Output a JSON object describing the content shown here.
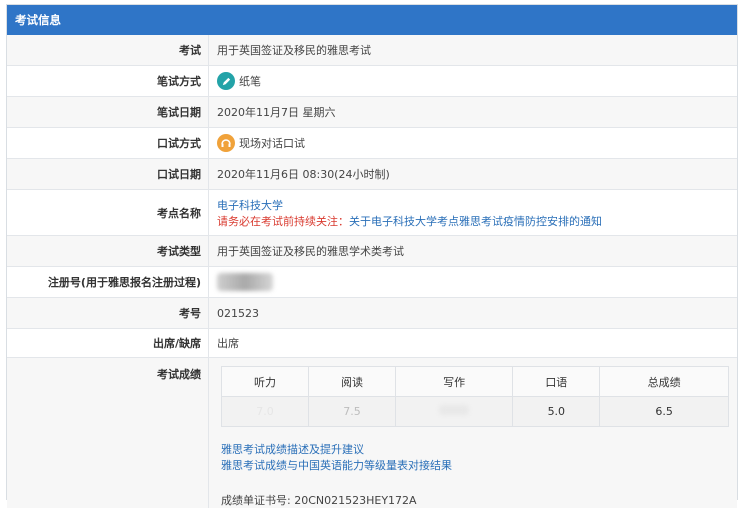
{
  "header": {
    "title": "考试信息"
  },
  "rows": {
    "exam": {
      "label": "考试",
      "value": "用于英国签证及移民的雅思考试"
    },
    "written": {
      "label": "笔试方式",
      "value": "纸笔",
      "icon": "pencil-icon"
    },
    "wdate": {
      "label": "笔试日期",
      "value": "2020年11月7日 星期六"
    },
    "oral": {
      "label": "口试方式",
      "value": "现场对话口试",
      "icon": "headset-icon"
    },
    "odate": {
      "label": "口试日期",
      "value": "2020年11月6日 08:30(24小时制)"
    },
    "venue": {
      "label": "考点名称",
      "value": "电子科技大学",
      "notice_prefix": "请务必在考试前持续关注：",
      "notice_link": "关于电子科技大学考点雅思考试疫情防控安排的通知"
    },
    "type": {
      "label": "考试类型",
      "value": "用于英国签证及移民的雅思学术类考试"
    },
    "reg": {
      "label": "注册号(用于雅思报名注册过程)"
    },
    "cand": {
      "label": "考号",
      "value": "021523"
    },
    "attend": {
      "label": "出席/缺席",
      "value": "出席"
    },
    "scores": {
      "label": "考试成绩",
      "headers": [
        "听力",
        "阅读",
        "写作",
        "口语",
        "总成绩"
      ],
      "values": [
        "7.0",
        "7.5",
        "",
        "5.0",
        "6.5"
      ],
      "link1": "雅思考试成绩描述及提升建议",
      "link2": "雅思考试成绩与中国英语能力等级量表对接结果",
      "cert": "成绩单证书号: 20CN021523HEY172A"
    }
  },
  "colors": {
    "header_bg": "#2f75c7",
    "link": "#2a6fb8",
    "warning": "#d93a2f"
  }
}
